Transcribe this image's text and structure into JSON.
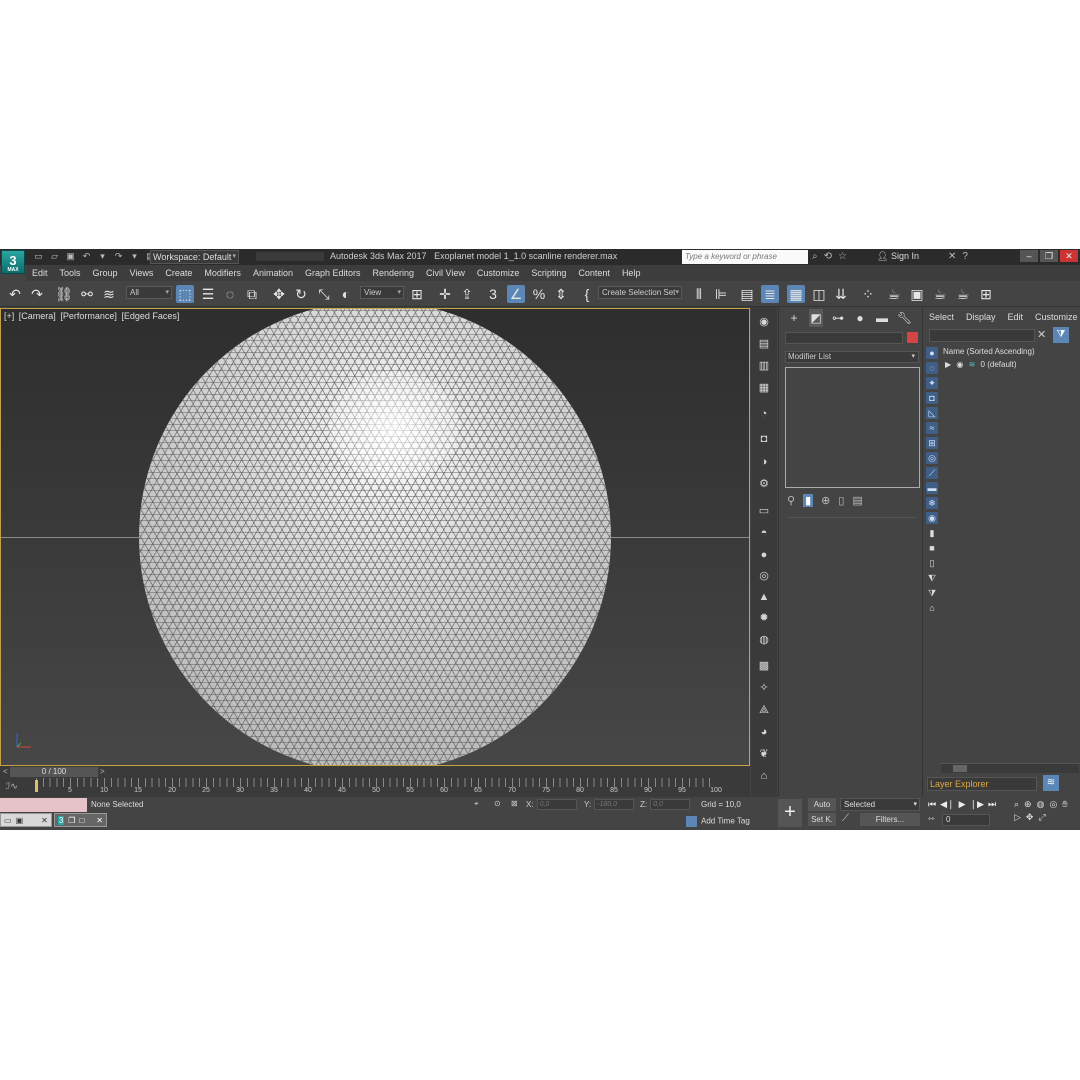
{
  "app": {
    "logo": "3",
    "logo_sub": "MAX",
    "workspace_label": "Workspace: Default",
    "title_app": "Autodesk 3ds Max 2017",
    "title_file": "Exoplanet model 1_1.0 scanline renderer.max",
    "search_placeholder": "Type a keyword or phrase",
    "sign_in": "Sign In"
  },
  "menu": [
    "Edit",
    "Tools",
    "Group",
    "Views",
    "Create",
    "Modifiers",
    "Animation",
    "Graph Editors",
    "Rendering",
    "Civil View",
    "Customize",
    "Scripting",
    "Content",
    "Help"
  ],
  "toolbar": {
    "selection_filter": "All",
    "ref_coord": "View",
    "selection_set_placeholder": "Create Selection Set"
  },
  "viewport": {
    "label_plus": "[+]",
    "label_camera": "[Camera]",
    "label_shading": "[Performance]",
    "label_edges": "[Edged Faces]"
  },
  "modify_panel": {
    "modifier_list": "Modifier List",
    "object_color": "#d64545"
  },
  "scene_explorer": {
    "menu": [
      "Select",
      "Display",
      "Edit",
      "Customize"
    ],
    "sort_header": "Name (Sorted Ascending)",
    "layer": "0 (default)",
    "layer_explorer": "Layer Explorer"
  },
  "timeline": {
    "frame_display": "0 / 100",
    "ticks": [
      "5",
      "10",
      "15",
      "20",
      "25",
      "30",
      "35",
      "40",
      "45",
      "50",
      "55",
      "60",
      "65",
      "70",
      "75",
      "80",
      "85",
      "90",
      "95",
      "100"
    ]
  },
  "status": {
    "selection": "None Selected",
    "x_label": "X:",
    "x_value": "0,0",
    "y_label": "Y:",
    "y_value": "-180,0",
    "z_label": "Z:",
    "z_value": "0,0",
    "grid": "Grid = 10,0",
    "add_time_tag": "Add Time Tag"
  },
  "anim": {
    "auto": "Auto",
    "set_key": "Set K.",
    "selected": "Selected",
    "filters": "Filters...",
    "current_frame": "0"
  }
}
